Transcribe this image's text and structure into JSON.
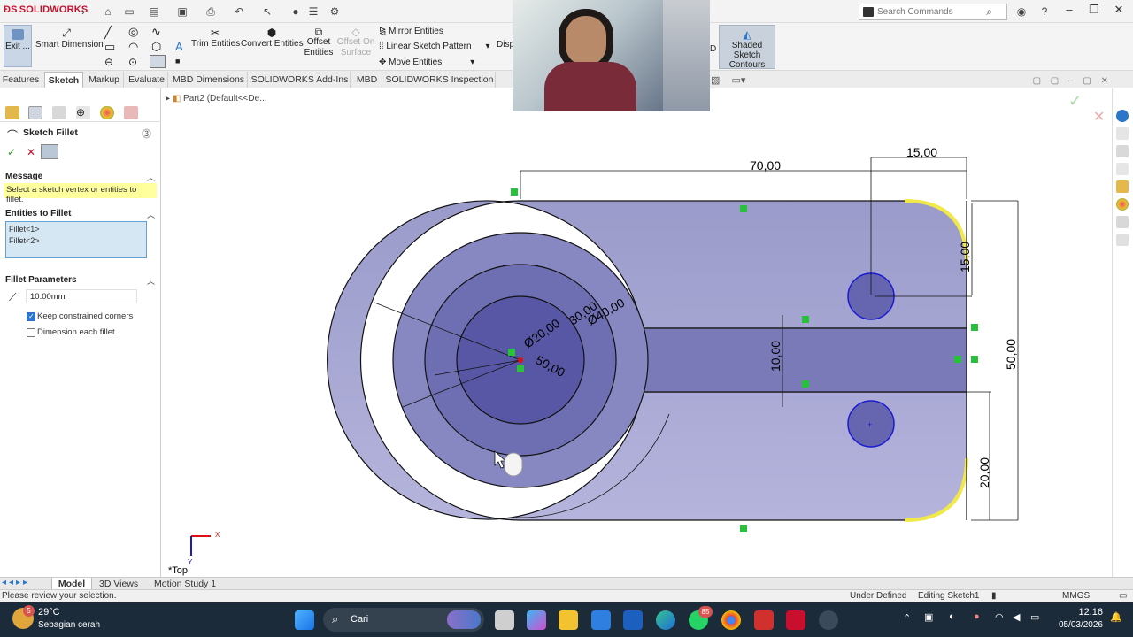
{
  "app": {
    "brand": "SOLIDWORKS",
    "search_placeholder": "Search Commands"
  },
  "ribbon": {
    "exit_sketch": "Exit ...",
    "smart_dimension": "Smart Dimension",
    "trim_entities": "Trim Entities",
    "convert_entities": "Convert Entities",
    "offset_entities_l1": "Offset",
    "offset_entities_l2": "Entities",
    "offset_on_surface_l1": "Offset On",
    "offset_on_surface_l2": "Surface",
    "mirror_entities": "Mirror Entities",
    "linear_sketch_pattern": "Linear Sketch Pattern",
    "move_entities": "Move Entities",
    "display_partial": "Disp",
    "shaded_contours_l1": "Shaded Sketch",
    "shaded_contours_l2": "Contours",
    "d_partial": "D"
  },
  "tabs": [
    "Features",
    "Sketch",
    "Markup",
    "Evaluate",
    "MBD Dimensions",
    "SOLIDWORKS Add-Ins",
    "MBD",
    "SOLIDWORKS Inspection"
  ],
  "active_tab": "Sketch",
  "tree": {
    "part": "Part2  (Default<<De..."
  },
  "property_manager": {
    "title": "Sketch Fillet",
    "message_header": "Message",
    "message": "Select a sketch vertex or entities to fillet.",
    "entities_header": "Entities to Fillet",
    "entities": [
      "Fillet<1>",
      "Fillet<2>"
    ],
    "params_header": "Fillet Parameters",
    "radius": "10.00mm",
    "keep_constrained": {
      "label": "Keep constrained corners",
      "checked": true
    },
    "dimension_each": {
      "label": "Dimension each fillet",
      "checked": false
    }
  },
  "sketch": {
    "dims": {
      "d70": "70,00",
      "d15_top": "15,00",
      "d15_vert": "15,00",
      "d50": "50,00",
      "d10": "10,00",
      "d20": "20,00",
      "dia20": "Ø20,00",
      "dia30": "30,00",
      "dia40": "Ø40,00",
      "r50": "50,00"
    },
    "view_label": "*Top",
    "axis_x": "X",
    "axis_y": "Y"
  },
  "bottom_tabs": [
    "Model",
    "3D Views",
    "Motion Study 1"
  ],
  "active_bottom_tab": "Model",
  "status": {
    "hint": "Please review your selection.",
    "state": "Under Defined",
    "editing": "Editing Sketch1",
    "units": "MMGS"
  },
  "taskbar": {
    "weather_temp": "29°C",
    "weather_desc": "Sebagian cerah",
    "weather_badge": "5",
    "search": "Cari",
    "time": "12.16",
    "date": "05/03/2026",
    "whatsapp_badge": "85"
  },
  "colors": {
    "sketch_fill": "#a9a9d6",
    "sketch_inner": "#6666b0",
    "fillet_highlight": "#f1e84a",
    "accent_blue": "#2b76c8",
    "message_yellow": "#ffff9e",
    "taskbar_bg": "#1c2b3a"
  }
}
